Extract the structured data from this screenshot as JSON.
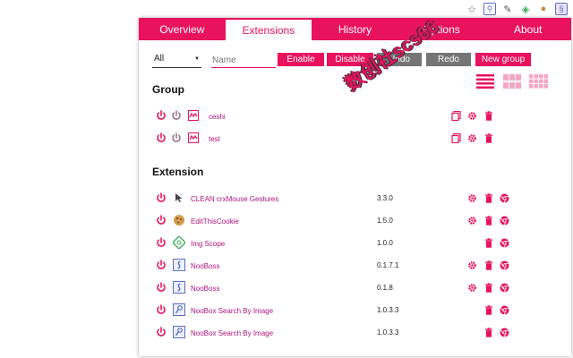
{
  "nav": {
    "tabs": [
      "Overview",
      "Extensions",
      "History",
      "Options",
      "About"
    ],
    "active": "Extensions"
  },
  "controls": {
    "filter_value": "All",
    "name_placeholder": "Name",
    "enable": "Enable",
    "disable": "Disable",
    "undo": "Undo",
    "redo": "Redo",
    "new_group": "New group"
  },
  "group_section": {
    "title": "Group",
    "groups": [
      {
        "name": "ceshi"
      },
      {
        "name": "test"
      }
    ]
  },
  "extension_section": {
    "title": "Extension",
    "extensions": [
      {
        "name": "CLEAN crxMouse Gestures",
        "version": "3.3.0",
        "has_options": true,
        "icon": "mouse-gestures-icon"
      },
      {
        "name": "EditThisCookie",
        "version": "1.5.0",
        "has_options": true,
        "icon": "cookie-icon"
      },
      {
        "name": "Img Scope",
        "version": "1.0.0",
        "has_options": false,
        "icon": "img-scope-icon"
      },
      {
        "name": "NooBoss",
        "version": "0.1.7.1",
        "has_options": true,
        "icon": "nooboss-icon"
      },
      {
        "name": "NooBoss",
        "version": "0.1.8",
        "has_options": true,
        "icon": "nooboss-icon"
      },
      {
        "name": "NooBox Search By Image",
        "version": "1.0.3.3",
        "has_options": false,
        "icon": "noobox-icon"
      },
      {
        "name": "NooBox Search By Image",
        "version": "1.0.3.3",
        "has_options": false,
        "icon": "noobox-icon"
      }
    ]
  },
  "watermark": "数创社scs66",
  "colors": {
    "accent": "#e8125f",
    "gray_button": "#757575",
    "name_text": "#b0127f"
  }
}
